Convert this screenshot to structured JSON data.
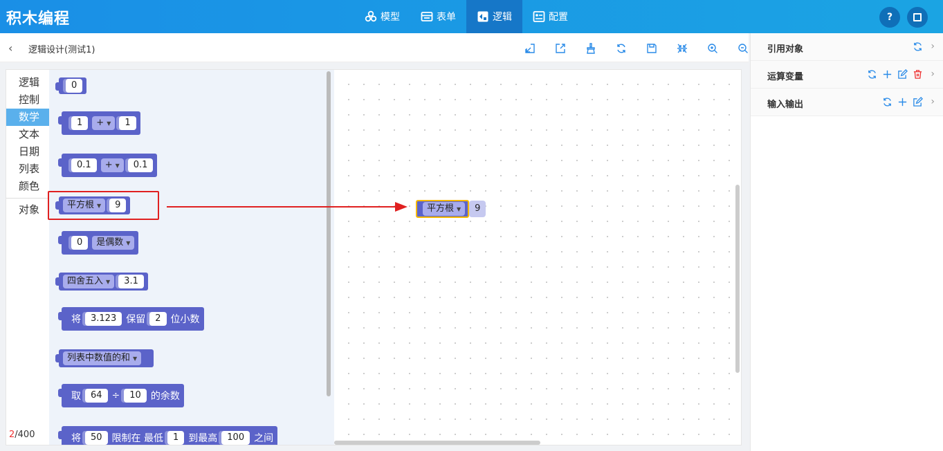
{
  "app": {
    "title": "积木编程"
  },
  "nav": [
    {
      "label": "模型",
      "icon": "model-icon",
      "active": false
    },
    {
      "label": "表单",
      "icon": "form-icon",
      "active": false
    },
    {
      "label": "逻辑",
      "icon": "logic-icon",
      "active": true
    },
    {
      "label": "配置",
      "icon": "config-icon",
      "active": false
    }
  ],
  "subbar": {
    "title": "逻辑设计(测试1)"
  },
  "categories": [
    "逻辑",
    "控制",
    "数学",
    "文本",
    "日期",
    "列表",
    "颜色",
    "对象"
  ],
  "active_category": "数学",
  "counter": {
    "current": "2",
    "total": "/400"
  },
  "blocks": {
    "b0": {
      "v": "0"
    },
    "b1": {
      "a": "1",
      "op": "+",
      "b": "1"
    },
    "b2": {
      "a": "0.1",
      "op": "+",
      "b": "0.1"
    },
    "b3": {
      "fn": "平方根",
      "v": "9"
    },
    "b4": {
      "v": "0",
      "fn": "是偶数"
    },
    "b5": {
      "fn": "四舍五入",
      "v": "3.1"
    },
    "b6": {
      "t1": "将",
      "v": "3.123",
      "t2": "保留",
      "n": "2",
      "t3": "位小数"
    },
    "b7": {
      "fn": "列表中数值的和"
    },
    "b8": {
      "t1": "取",
      "a": "64",
      "op": "÷",
      "b": "10",
      "t2": "的余数"
    },
    "b9": {
      "t1": "将",
      "v": "50",
      "t2": "限制在 最低",
      "lo": "1",
      "t3": "到最高",
      "hi": "100",
      "t4": "之间"
    }
  },
  "canvas_block": {
    "fn": "平方根",
    "v": "9"
  },
  "right_panel": [
    {
      "label": "引用对象"
    },
    {
      "label": "运算变量"
    },
    {
      "label": "输入输出"
    }
  ],
  "colors": {
    "block": "#5b63c9",
    "highlight": "#e02020",
    "accent": "#2a8be8"
  }
}
